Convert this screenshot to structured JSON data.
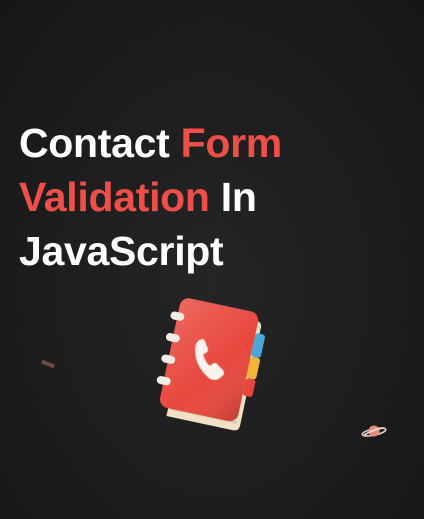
{
  "headline": {
    "line1_white": "Contact ",
    "line1_accent": "Form",
    "line2_accent": "Validation",
    "line2_white": " In",
    "line3_white": "JavaScript"
  },
  "colors": {
    "background": "#1b1b1c",
    "text": "#ffffff",
    "accent": "#ef4f48",
    "book_cover": "#e8473c",
    "book_pages": "#f3e6cf",
    "tab_blue": "#4aa8d8",
    "tab_yellow": "#f2b43a"
  },
  "icons": {
    "illustration": "address-book-icon",
    "phone": "phone-icon",
    "planet": "planet-icon"
  }
}
